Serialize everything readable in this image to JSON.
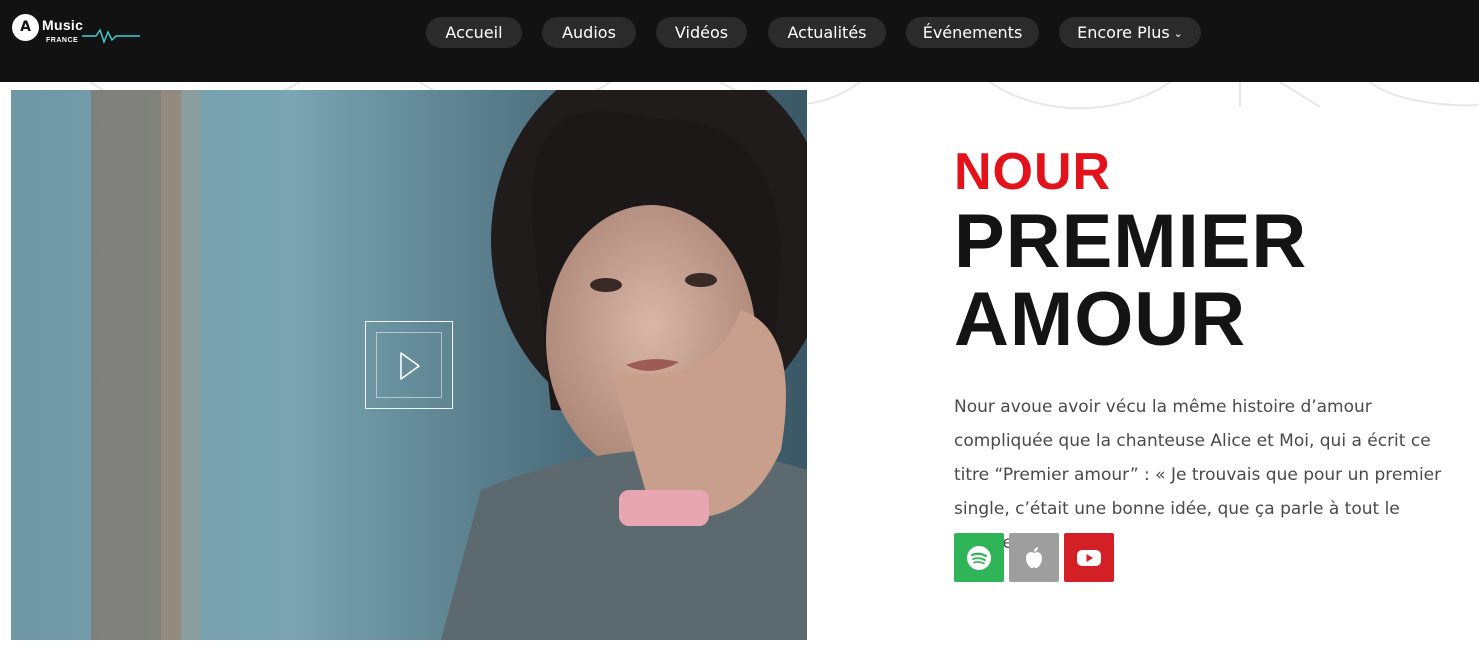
{
  "header": {
    "logo": {
      "word": "Music",
      "letter": "A",
      "sub": "FRANCE"
    },
    "nav": [
      {
        "label": "Accueil"
      },
      {
        "label": "Audios"
      },
      {
        "label": "Vidéos"
      },
      {
        "label": "Actualités"
      },
      {
        "label": "Événements"
      },
      {
        "label": "Encore Plus"
      }
    ]
  },
  "feature": {
    "artist": "NOUR",
    "title_line1": "PREMIER",
    "title_line2": "AMOUR",
    "description": "Nour avoue avoir vécu la même histoire d’amour compliquée que la chanteuse Alice et Moi, qui a écrit ce titre “Premier amour” : « Je trouvais que pour un premier single, c’était une bonne idée, que ça parle à tout le monde.",
    "play_icon": "play-icon",
    "streaming": [
      {
        "icon": "spotify-icon",
        "color": "#2fb457"
      },
      {
        "icon": "apple-icon",
        "color": "#9e9e9e"
      },
      {
        "icon": "youtube-icon",
        "color": "#d32027"
      }
    ]
  },
  "colors": {
    "accent": "#e3131b",
    "nav_bg": "#121212",
    "pill_bg": "#2b2b2b"
  }
}
